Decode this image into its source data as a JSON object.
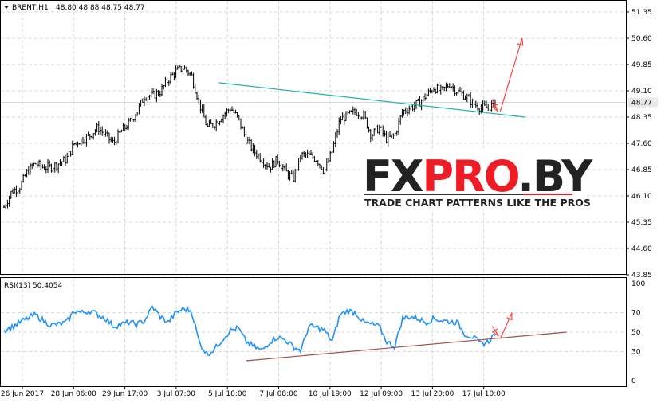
{
  "header": {
    "symbol": "BRENT,H1",
    "ohlc": "48.80 48.88 48.75 48.77"
  },
  "rsi_header": {
    "label": "RSI(13) 50.4054"
  },
  "logo": {
    "part1": "FX",
    "part2": "PRO",
    "part3": ".BY",
    "tagline": "TRADE CHART PATTERNS LIKE THE PROS"
  },
  "colors": {
    "bars": "#000000",
    "trend_price": "#20b2aa",
    "trend_rsi": "#a05050",
    "arrow": "#ff4040",
    "rsi": "#1e90ff",
    "grid": "#d8d8d8",
    "current_price_bg": "#e8e8e8"
  },
  "chart_data": [
    {
      "type": "ohlc",
      "title": "BRENT,H1",
      "ylim": [
        43.85,
        51.35
      ],
      "yticks": [
        "51.35",
        "50.60",
        "49.85",
        "49.10",
        "48.35",
        "47.60",
        "46.85",
        "46.10",
        "45.35",
        "44.60",
        "43.85"
      ],
      "current_price": "48.77",
      "xticks": [
        "26 Jun 2017",
        "28 Jun 06:00",
        "29 Jun 17:00",
        "3 Jul 07:00",
        "5 Jul 18:00",
        "7 Jul 08:00",
        "10 Jul 19:00",
        "12 Jul 09:00",
        "13 Jul 20:00",
        "17 Jul 10:00"
      ],
      "close": [
        45.78,
        46.24,
        46.35,
        46.8,
        47.03,
        46.92,
        46.92,
        47.03,
        47.15,
        47.6,
        47.71,
        47.83,
        48.05,
        47.83,
        47.6,
        47.94,
        48.17,
        48.51,
        48.96,
        48.96,
        49.08,
        49.42,
        49.65,
        49.76,
        49.53,
        48.74,
        48.05,
        48.17,
        48.4,
        48.62,
        48.28,
        47.71,
        47.37,
        47.15,
        46.92,
        47.15,
        46.8,
        46.58,
        47.26,
        47.26,
        47.15,
        46.8,
        47.37,
        48.28,
        48.4,
        48.51,
        48.4,
        47.83,
        48.05,
        47.71,
        47.83,
        48.51,
        48.62,
        48.74,
        48.96,
        49.19,
        49.08,
        49.3,
        49.08,
        48.96,
        48.74,
        48.62,
        48.62,
        48.77
      ],
      "trendline": {
        "from_index": 27.5,
        "from_price": 49.33,
        "to_index": 66.7,
        "to_price": 48.35
      },
      "arrow_up": {
        "from_index": 63.5,
        "from_price": 48.51,
        "to_index": 66.3,
        "to_price": 50.6
      },
      "arrow_small": {
        "from_index": 62.5,
        "from_price": 48.85,
        "to_index": 63.2,
        "to_price": 48.51
      }
    },
    {
      "type": "line",
      "title": "RSI(13) 50.4054",
      "ylim": [
        0,
        100
      ],
      "yticks": [
        "100",
        "70",
        "50",
        "30",
        "0"
      ],
      "values": [
        52,
        55,
        60,
        64,
        68,
        62,
        57,
        58,
        60,
        72,
        70,
        72,
        68,
        64,
        56,
        58,
        60,
        58,
        62,
        76,
        66,
        60,
        70,
        74,
        72,
        39,
        27,
        33,
        43,
        52,
        54,
        40,
        35,
        31,
        40,
        45,
        42,
        35,
        31,
        56,
        55,
        52,
        40,
        68,
        72,
        70,
        60,
        58,
        56,
        40,
        35,
        64,
        66,
        64,
        60,
        64,
        62,
        61,
        60,
        48,
        45,
        38,
        40,
        50.4
      ],
      "trendline": {
        "from_index": 31,
        "from_value": 20.5,
        "to_index": 72,
        "to_value": 50
      },
      "arrow_up": {
        "from_index": 63.5,
        "from_value": 43,
        "to_index": 65,
        "to_value": 70
      },
      "arrow_small": {
        "from_index": 62.5,
        "from_value": 56,
        "to_index": 63.3,
        "to_value": 46
      }
    }
  ]
}
